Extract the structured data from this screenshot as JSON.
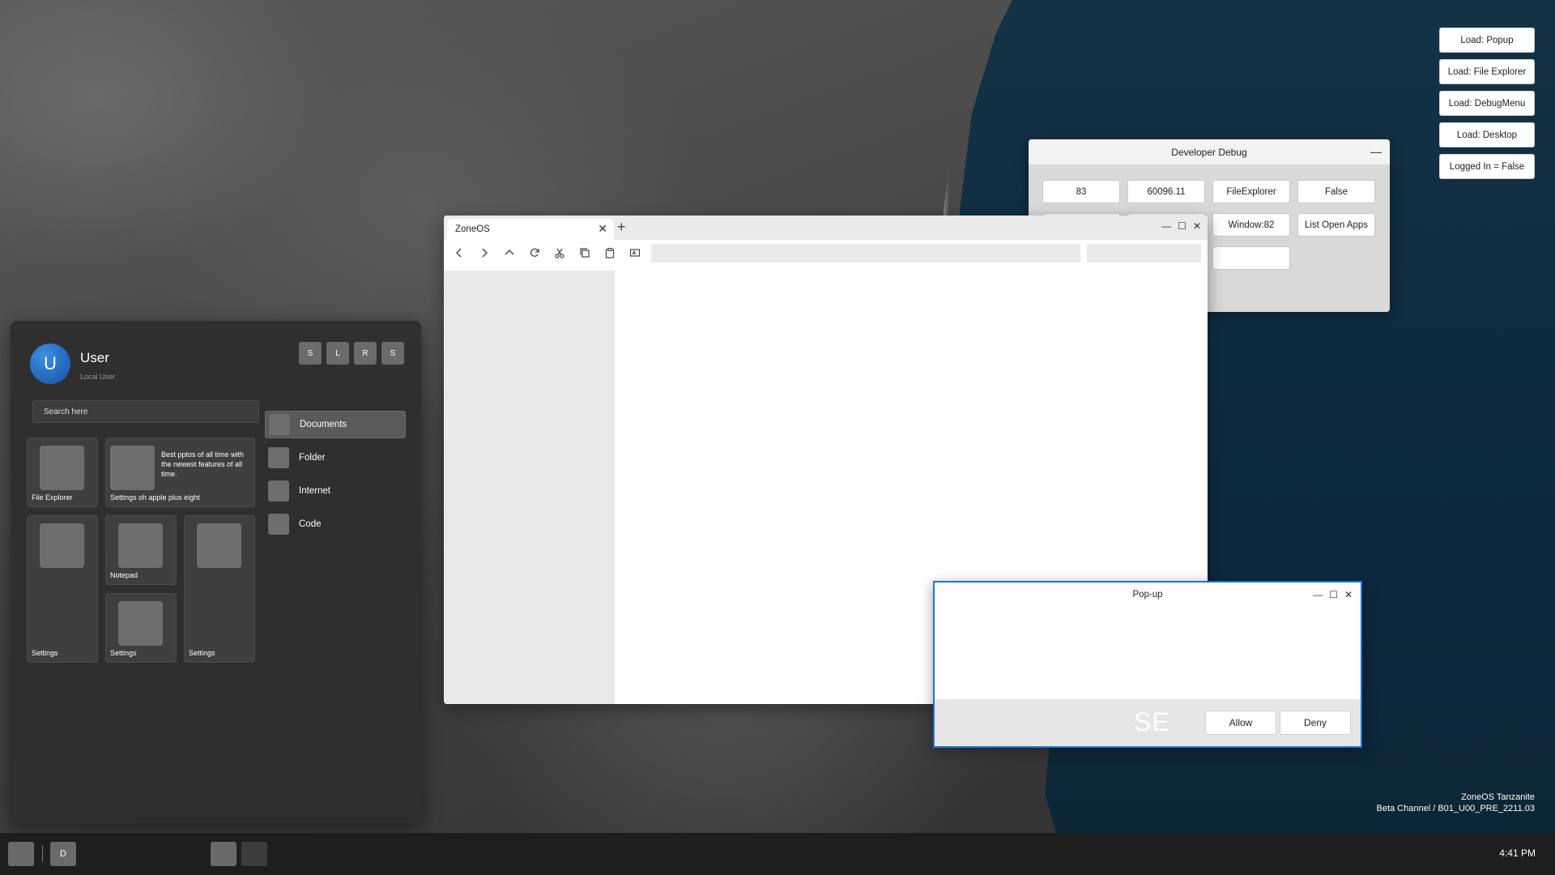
{
  "debug_load_buttons": [
    "Load: Popup",
    "Load: File Explorer",
    "Load: DebugMenu",
    "Load: Desktop",
    "Logged In = False"
  ],
  "developer_debug": {
    "title": "Developer Debug",
    "minimize_glyph": "—",
    "buttons": [
      "83",
      "60096.11",
      "FileExplorer",
      "False",
      "",
      "",
      "Window:82",
      "List Open Apps",
      "",
      "",
      "",
      ""
    ]
  },
  "explorer": {
    "tab_title": "ZoneOS",
    "tab_close_glyph": "✕",
    "new_tab_glyph": "+",
    "window_controls": [
      "—",
      "☐",
      "✕"
    ],
    "toolbar_icons": [
      "back-icon",
      "forward-icon",
      "up-icon",
      "refresh-icon",
      "cut-icon",
      "copy-icon",
      "paste-icon",
      "rename-icon"
    ],
    "address_value": "",
    "search_value": ""
  },
  "popup": {
    "title": "Pop-up",
    "window_controls": [
      "—",
      "☐",
      "✕"
    ],
    "logo_text": "SE",
    "allow_label": "Allow",
    "deny_label": "Deny"
  },
  "start_menu": {
    "user_initial": "U",
    "user_name": "User",
    "user_sub": "Local User",
    "power_buttons": [
      "S",
      "L",
      "R",
      "S"
    ],
    "search_placeholder": "Search here",
    "tiles": {
      "file_explorer": "File Explorer",
      "settings_wide": "Settings oh apple plus eight",
      "settings_wide_desc": "Best pptos of all time with the newest features of all time.",
      "settings_left": "Settings",
      "notepad": "Notepad",
      "settings_mid": "Settings",
      "settings_right": "Settings"
    },
    "quick_links": [
      "Documents",
      "Folder",
      "Internet",
      "Code"
    ]
  },
  "taskbar": {
    "pinned_label": "D",
    "clock": "4:41 PM"
  },
  "build_info": {
    "line1": "ZoneOS Tanzanite",
    "line2": "Beta Channel / B01_U00_PRE_2211.03"
  }
}
